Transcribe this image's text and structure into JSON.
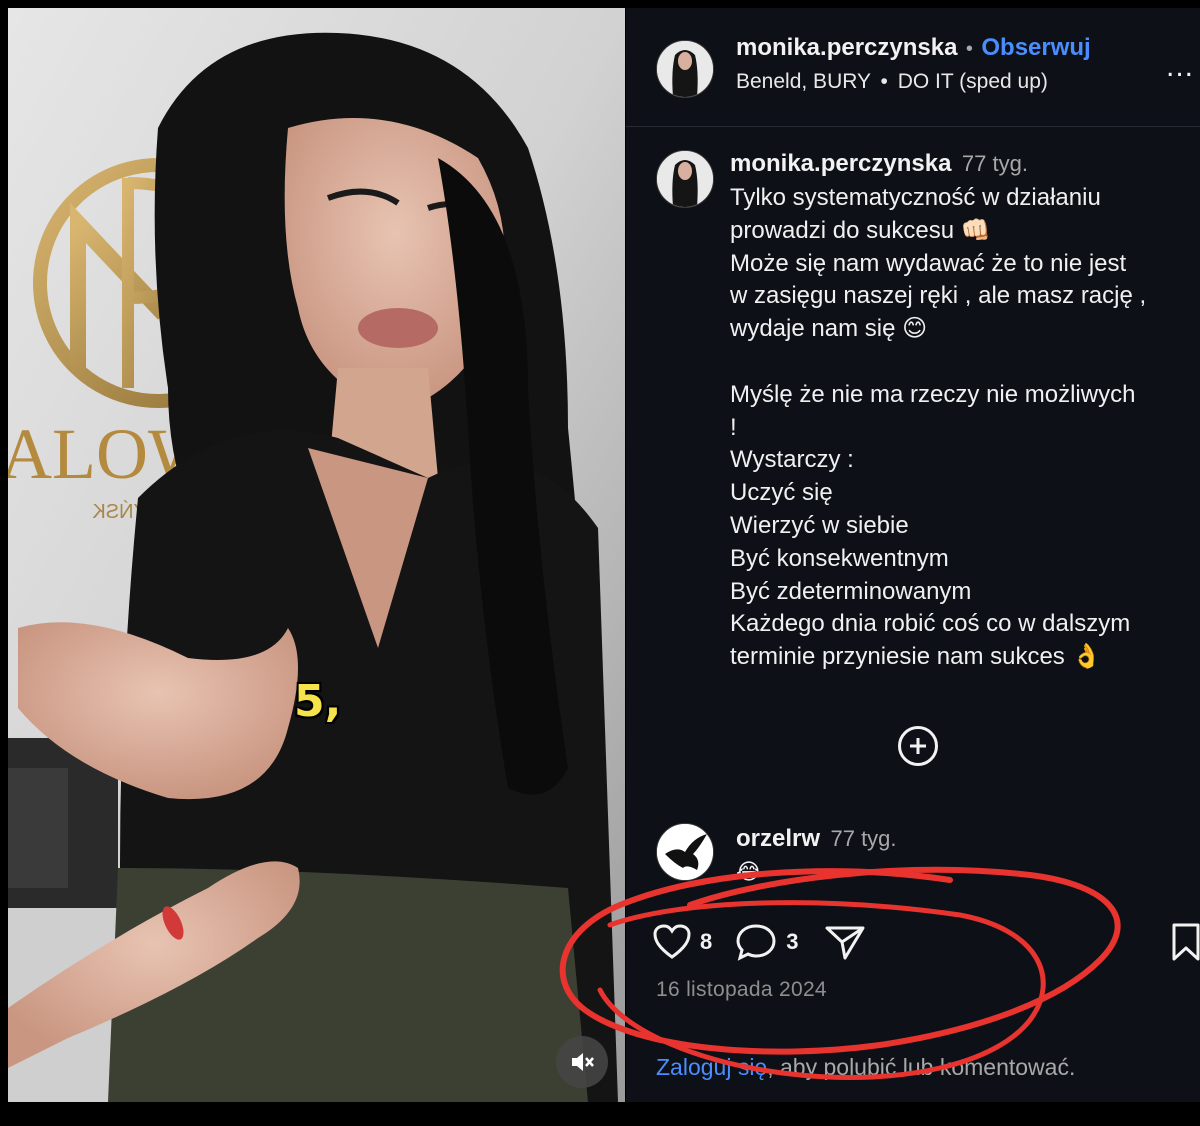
{
  "post": {
    "username": "monika.perczynska",
    "separator": "•",
    "follow_label": "Obserwuj",
    "song_artist": "Beneld, BURY",
    "song_separator": "•",
    "song_title": "DO IT (sped up)",
    "more_label": "..."
  },
  "video": {
    "caption_overlay": "5,",
    "sign_text": "ALOW",
    "sign_text_small": "RCZYŃSK"
  },
  "caption": {
    "username": "monika.perczynska",
    "time": "77 tyg.",
    "text": "Tylko systematyczność w działaniu\nprowadzi do sukcesu 👊🏻\nMoże się nam wydawać że to nie jest\nw zasięgu naszej ręki , ale masz rację ,\nwydaje nam się 😊\n\nMyślę że nie ma rzeczy nie możliwych\n!\nWystarczy :\nUczyć się\nWierzyć w siebie\nByć konsekwentnym\nByć zdeterminowanym\nKażdego dnia robić coś co w dalszym\nterminie przyniesie nam sukces 👌"
  },
  "comment": {
    "username": "orzelrw",
    "time": "77 tyg.",
    "text": "😂"
  },
  "actions": {
    "likes": "8",
    "comments": "3"
  },
  "date": "16 listopada 2024",
  "login": {
    "link": "Zaloguj się",
    "rest": ", aby polubić lub komentować."
  },
  "colors": {
    "panel_bg": "#0d1117",
    "link_blue": "#4a8dff",
    "annotation_red": "#e8332e"
  },
  "icons": [
    "more-icon",
    "plus-circle-icon",
    "heart-icon",
    "comment-icon",
    "share-icon",
    "bookmark-icon",
    "mute-icon"
  ]
}
